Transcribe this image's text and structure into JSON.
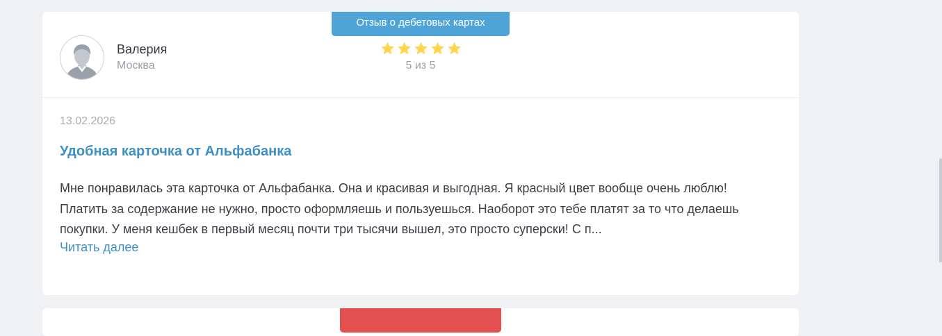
{
  "reviews": [
    {
      "category": "Отзыв о дебетовых картах",
      "author": {
        "name": "Валерия",
        "city": "Москва"
      },
      "rating": {
        "stars": 5,
        "text": "5 из 5",
        "star_color": "#ffd54f"
      },
      "date": "13.02.2026",
      "title": "Удобная карточка от Альфабанка",
      "text": "Мне понравилась эта карточка от Альфабанка. Она и красивая и выгодная. Я красный цвет вообще очень люблю! Платить за содержание не нужно, просто оформляешь и пользуешься. Наоборот это тебе платят за то что делаешь покупки. У меня кешбек в первый месяц почти три тысячи вышел, это просто суперски! С п...",
      "read_more": "Читать далее"
    },
    {
      "category": ""
    }
  ],
  "colors": {
    "accent": "#3d8fc4",
    "tag_debit": "#4fa3d6",
    "tag_next": "#e45050",
    "background": "#eff1f4"
  }
}
